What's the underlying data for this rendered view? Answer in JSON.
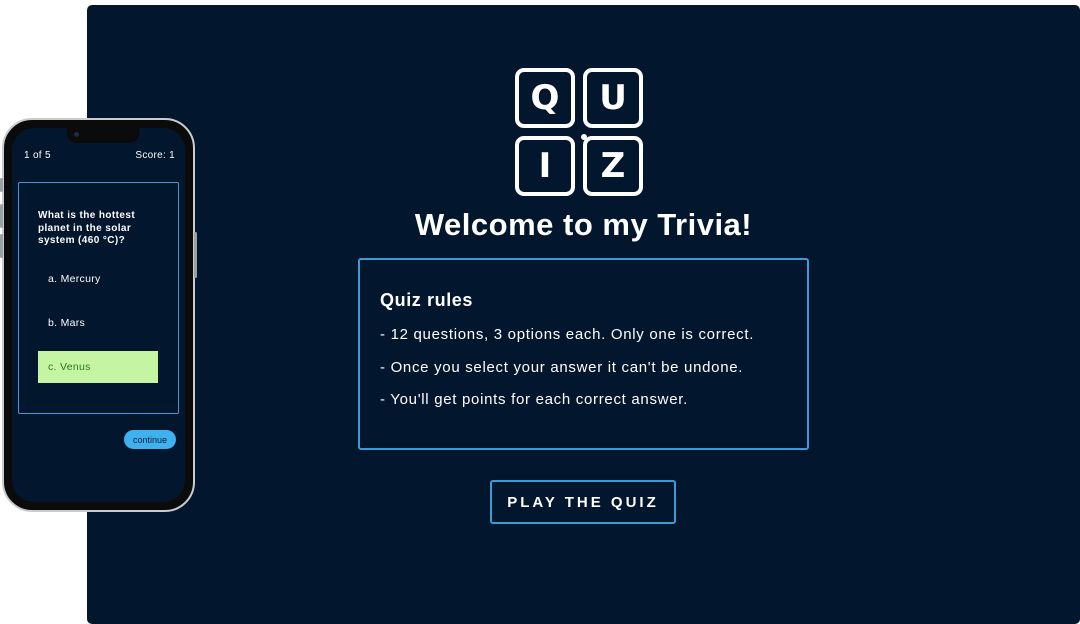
{
  "desktop": {
    "logo": {
      "letters": [
        "Q",
        "U",
        "I",
        "Z"
      ]
    },
    "title": "Welcome to my Trivia!",
    "rules": {
      "heading": "Quiz rules",
      "items": [
        "- 12 questions, 3 options each. Only one is correct.",
        "- Once you select your answer it can't be undone.",
        "- You'll get points for each correct answer."
      ]
    },
    "play_button": "PLAY THE QUIZ"
  },
  "phone": {
    "progress": "1 of 5",
    "score": "Score: 1",
    "question": "What is the hottest planet in the solar system (460 °C)?",
    "options": [
      {
        "label": "a. Mercury",
        "state": "default"
      },
      {
        "label": "b. Mars",
        "state": "default"
      },
      {
        "label": "c. Venus",
        "state": "correct"
      }
    ],
    "continue_button": "continue"
  },
  "colors": {
    "background": "#02162d",
    "accent_border": "#3d9ad6",
    "correct_option_bg": "#c5f5a2",
    "continue_button_bg": "#3fb1ee"
  }
}
